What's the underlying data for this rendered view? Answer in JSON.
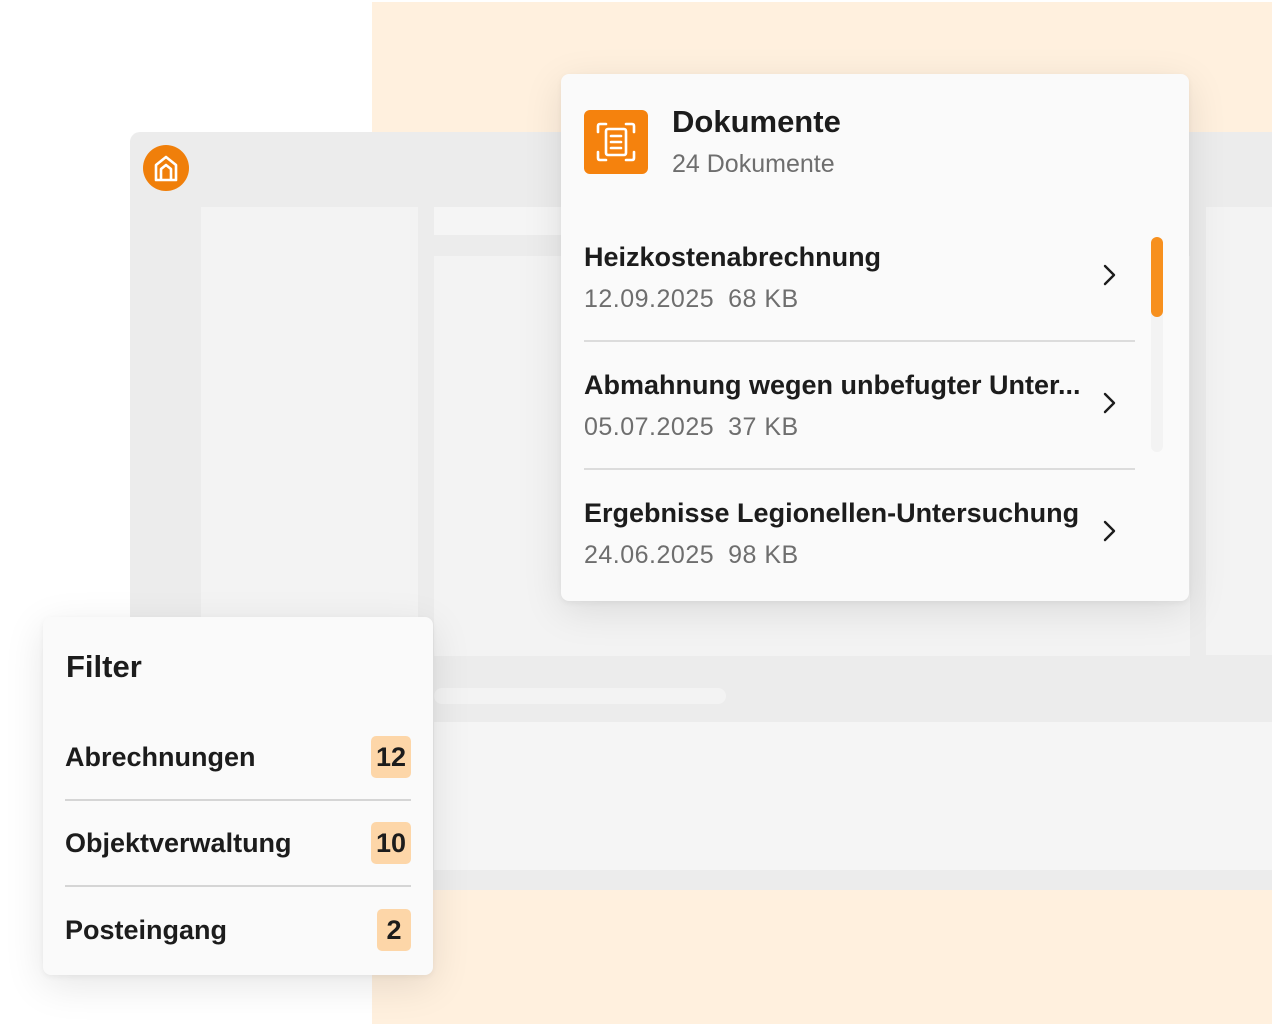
{
  "colors": {
    "accent": "#f5820d",
    "accent_light": "#fdd6a8",
    "background_peach": "#fff0de",
    "window_gray": "#ececec"
  },
  "app": {
    "logo_icon": "house-icon"
  },
  "documents": {
    "icon": "document-scan-icon",
    "title": "Dokumente",
    "count_label": "24 Dokumente",
    "items": [
      {
        "name": "Heizkostenabrechnung",
        "date": "12.09.2025",
        "size": "68 KB",
        "chevron": "chevron-right-icon"
      },
      {
        "name": "Abmahnung wegen unbefugter Unter...",
        "date": "05.07.2025",
        "size": "37 KB",
        "chevron": "chevron-right-icon"
      },
      {
        "name": "Ergebnisse Legionellen-Untersuchung",
        "date": "24.06.2025",
        "size": "98 KB",
        "chevron": "chevron-right-icon"
      }
    ]
  },
  "filter": {
    "title": "Filter",
    "items": [
      {
        "label": "Abrechnungen",
        "count": "12"
      },
      {
        "label": "Objektverwaltung",
        "count": "10"
      },
      {
        "label": "Posteingang",
        "count": "2"
      }
    ]
  }
}
